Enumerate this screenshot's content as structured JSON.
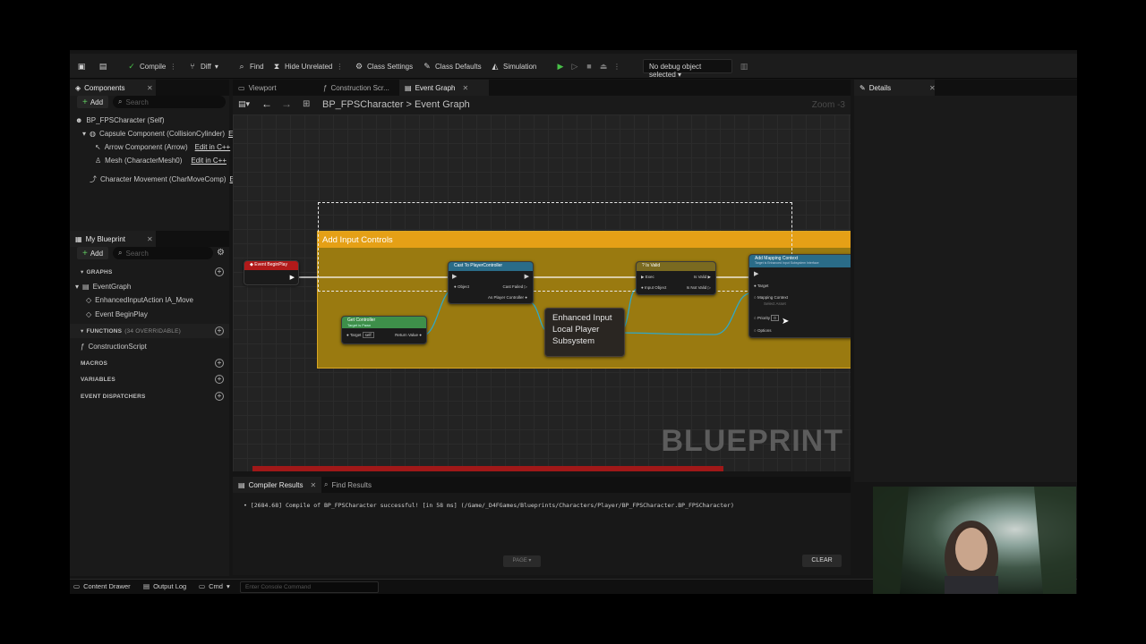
{
  "toolbar": {
    "compile": "Compile",
    "diff": "Diff",
    "find": "Find",
    "hide_unrelated": "Hide Unrelated",
    "class_settings": "Class Settings",
    "class_defaults": "Class Defaults",
    "simulation": "Simulation",
    "debug_object": "No debug object selected"
  },
  "components": {
    "tab": "Components",
    "add": "Add",
    "search_placeholder": "Search",
    "items": [
      {
        "label": "BP_FPSCharacter (Self)"
      },
      {
        "label": "Capsule Component (CollisionCylinder)",
        "link": "Ed"
      },
      {
        "label": "Arrow Component (Arrow)",
        "link": "Edit in C++"
      },
      {
        "label": "Mesh (CharacterMesh0)",
        "link": "Edit in C++"
      },
      {
        "label": "Character Movement (CharMoveComp)",
        "link": "E"
      }
    ]
  },
  "my_blueprint": {
    "tab": "My Blueprint",
    "add": "Add",
    "search_placeholder": "Search",
    "graphs_header": "GRAPHS",
    "event_graph": "EventGraph",
    "graph_items": [
      "EnhancedInputAction IA_Move",
      "Event BeginPlay"
    ],
    "functions_header": "FUNCTIONS",
    "functions_count": "(34 OVERRIDABLE)",
    "construction_script": "ConstructionScript",
    "macros": "MACROS",
    "variables": "VARIABLES",
    "event_dispatchers": "EVENT DISPATCHERS"
  },
  "editor_tabs": {
    "viewport": "Viewport",
    "construction": "Construction Scr...",
    "event_graph": "Event Graph"
  },
  "details": {
    "tab": "Details"
  },
  "graph": {
    "breadcrumb_root": "BP_FPSCharacter",
    "breadcrumb_sep": ">",
    "breadcrumb_current": "Event Graph",
    "zoom": "Zoom -3",
    "comment_title": "Add Input Controls",
    "watermark": "BLUEPRINT",
    "nodes": {
      "begin_play": "Event BeginPlay",
      "cast": "Cast To PlayerController",
      "cast_object": "Object",
      "cast_failed": "Cast Failed",
      "cast_as": "As Player Controller",
      "get_controller": "Get Controller",
      "get_controller_sub": "Target is Pawn",
      "get_target": "Target",
      "get_self": "self",
      "return_value": "Return Value",
      "subsystem": "Enhanced Input Local Player Subsystem",
      "is_valid": "Is Valid",
      "exec": "Exec",
      "input_object": "Input Object",
      "is_valid_out": "Is Valid",
      "is_not_valid": "Is Not Valid",
      "add_mapping": "Add Mapping Context",
      "add_mapping_sub": "Target is Enhanced Input Subsystem Interface",
      "target": "Target",
      "mapping_context": "Mapping Context",
      "mapping_select": "Select Asset",
      "priority": "Priority",
      "priority_value": "0",
      "options": "Options"
    }
  },
  "results": {
    "tab_compiler": "Compiler Results",
    "tab_find": "Find Results",
    "log": "[2684.68] Compile of BP_FPSCharacter successful! [in 58 ms] (/Game/_D4FGames/Blueprints/Characters/Player/BP_FPSCharacter.BP_FPSCharacter)",
    "page": "PAGE",
    "clear": "CLEAR"
  },
  "status": {
    "content_drawer": "Content Drawer",
    "output_log": "Output Log",
    "cmd": "Cmd",
    "console_placeholder": "Enter Console Command"
  },
  "colors": {
    "comment_header": "#e5a016",
    "comment_body": "#9a7a10",
    "exec_wire": "#ffffff",
    "object_wire": "#2fa8c8",
    "event_node": "#b21a1a",
    "pure_node": "#3e8f4a",
    "func_node": "#2a6c88"
  }
}
